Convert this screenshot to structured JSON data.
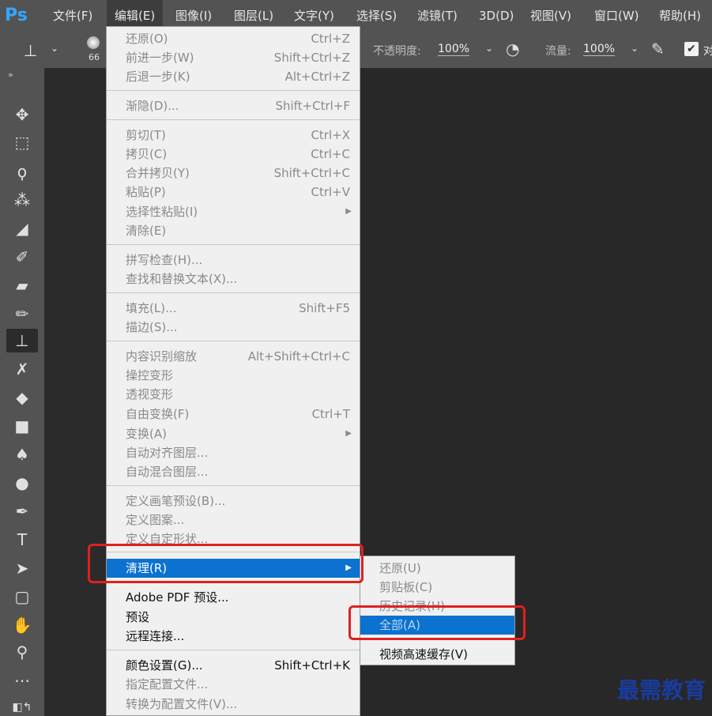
{
  "app": {
    "logo": "Ps"
  },
  "menubar": [
    {
      "label": "文件(F)"
    },
    {
      "label": "编辑(E)"
    },
    {
      "label": "图像(I)"
    },
    {
      "label": "图层(L)"
    },
    {
      "label": "文字(Y)"
    },
    {
      "label": "选择(S)"
    },
    {
      "label": "滤镜(T)"
    },
    {
      "label": "3D(D)"
    },
    {
      "label": "视图(V)"
    },
    {
      "label": "窗口(W)"
    },
    {
      "label": "帮助(H)"
    }
  ],
  "options": {
    "brush_size": "66",
    "opacity_label": "不透明度:",
    "opacity_value": "100%",
    "flow_label": "流量:",
    "flow_value": "100%",
    "align_label": "对"
  },
  "edit_menu": [
    {
      "label": "还原(O)",
      "shortcut": "Ctrl+Z"
    },
    {
      "label": "前进一步(W)",
      "shortcut": "Shift+Ctrl+Z"
    },
    {
      "label": "后退一步(K)",
      "shortcut": "Alt+Ctrl+Z"
    },
    {
      "label": "渐隐(D)...",
      "shortcut": "Shift+Ctrl+F"
    },
    {
      "label": "剪切(T)",
      "shortcut": "Ctrl+X"
    },
    {
      "label": "拷贝(C)",
      "shortcut": "Ctrl+C"
    },
    {
      "label": "合并拷贝(Y)",
      "shortcut": "Shift+Ctrl+C"
    },
    {
      "label": "粘贴(P)",
      "shortcut": "Ctrl+V"
    },
    {
      "label": "选择性粘贴(I)",
      "shortcut": ""
    },
    {
      "label": "清除(E)",
      "shortcut": ""
    },
    {
      "label": "拼写检查(H)...",
      "shortcut": ""
    },
    {
      "label": "查找和替换文本(X)...",
      "shortcut": ""
    },
    {
      "label": "填充(L)...",
      "shortcut": "Shift+F5"
    },
    {
      "label": "描边(S)...",
      "shortcut": ""
    },
    {
      "label": "内容识别缩放",
      "shortcut": "Alt+Shift+Ctrl+C"
    },
    {
      "label": "操控变形",
      "shortcut": ""
    },
    {
      "label": "透视变形",
      "shortcut": ""
    },
    {
      "label": "自由变换(F)",
      "shortcut": "Ctrl+T"
    },
    {
      "label": "变换(A)",
      "shortcut": ""
    },
    {
      "label": "自动对齐图层...",
      "shortcut": ""
    },
    {
      "label": "自动混合图层...",
      "shortcut": ""
    },
    {
      "label": "定义画笔预设(B)...",
      "shortcut": ""
    },
    {
      "label": "定义图案...",
      "shortcut": ""
    },
    {
      "label": "定义自定形状...",
      "shortcut": ""
    },
    {
      "label": "清理(R)",
      "shortcut": ""
    },
    {
      "label": "Adobe PDF 预设...",
      "shortcut": ""
    },
    {
      "label": "预设",
      "shortcut": ""
    },
    {
      "label": "远程连接...",
      "shortcut": ""
    },
    {
      "label": "颜色设置(G)...",
      "shortcut": "Shift+Ctrl+K"
    },
    {
      "label": "指定配置文件...",
      "shortcut": ""
    },
    {
      "label": "转换为配置文件(V)...",
      "shortcut": ""
    }
  ],
  "purge_menu": [
    {
      "label": "还原(U)"
    },
    {
      "label": "剪贴板(C)"
    },
    {
      "label": "历史记录(H)"
    },
    {
      "label": "全部(A)"
    },
    {
      "label": "视频高速缓存(V)"
    }
  ],
  "watermark": "最需教育"
}
